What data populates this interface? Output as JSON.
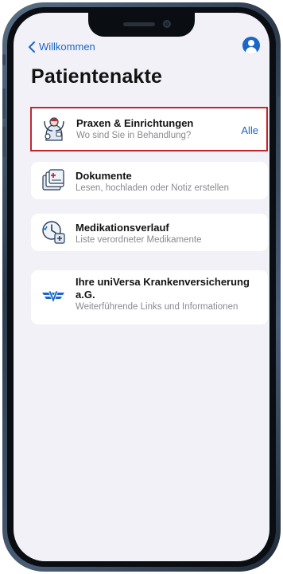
{
  "nav": {
    "back_label": "Willkommen"
  },
  "page": {
    "title": "Patientenakte"
  },
  "items": [
    {
      "title": "Praxen & Einrichtungen",
      "subtitle": "Wo sind Sie in Behandlung?",
      "action": "Alle",
      "icon": "doctor-icon"
    },
    {
      "title": "Dokumente",
      "subtitle": "Lesen, hochladen oder Notiz erstellen",
      "icon": "documents-icon"
    },
    {
      "title": "Medikationsverlauf",
      "subtitle": "Liste verordneter Medikamente",
      "icon": "medication-history-icon"
    },
    {
      "title": "Ihre uniVersa Krankenversicherung a.G.",
      "subtitle": "Weiterführende Links und Informationen",
      "icon": "insurance-logo-icon"
    }
  ],
  "colors": {
    "accent": "#1a66c9",
    "highlight": "#c3272e",
    "background": "#f2f1f7"
  }
}
